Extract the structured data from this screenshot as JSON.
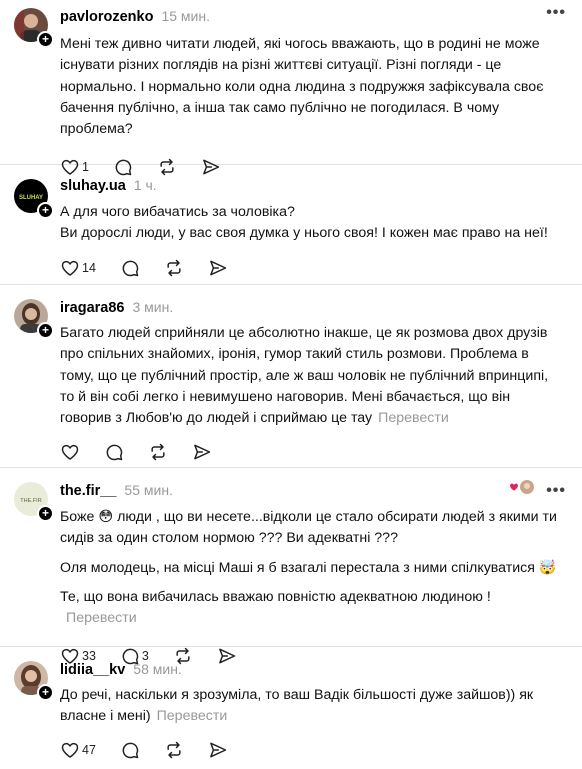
{
  "posts": [
    {
      "username": "pavlorozenko",
      "time": "15 мин.",
      "paragraphs": [
        "Мені теж дивно читати людей, які чогось вважають, що в родині не може існувати різних поглядів на різні життєві ситуації. Різні погляди - це нормально. І нормально коли одна людина з подружжя зафіксувала своє бачення публічно, а інша так само публічно не погодилася. В чому проблема?"
      ],
      "likes": "1",
      "replies": "",
      "translate": ""
    },
    {
      "username": "sluhay.ua",
      "time": "1 ч.",
      "paragraphs": [
        "А для чого вибачатись за чоловіка?",
        "Ви дорослі люди, у вас своя думка у нього своя! І кожен має право на неї!"
      ],
      "likes": "14",
      "replies": "",
      "translate": ""
    },
    {
      "username": "iragara86",
      "time": "3 мин.",
      "paragraphs": [
        "Багато людей сприйняли це абсолютно інакше, це як розмова двох друзів про спільних знайомих, іронія, гумор такий стиль розмови. Проблема в тому, що це публічний простір, але ж ваш чоловік не публічний впринципі, то й він собі легко і невимушено наговорив. Мені вбачається, що він говорив з Любов'ю до людей і сприймаю це тау"
      ],
      "likes": "",
      "replies": "",
      "translate": "Перевести"
    },
    {
      "username": "the.fir__",
      "time": "55 мин.",
      "paragraphs": [
        "Боже 😳 люди , що ви несете...відколи це стало обсирати людей з якими ти сидів за один столом нормою ??? Ви адекватні ???",
        "Оля молодець, на місці Маші я б взагалі перестала з ними спілкуватися 🤯",
        "Те, що вона вибачилась вважаю повністю адекватною людиною !"
      ],
      "likes": "33",
      "replies": "3",
      "translate": "Перевести"
    },
    {
      "username": "lidiia__kv",
      "time": "58 мин.",
      "paragraphs": [
        "До речі, наскільки я зрозуміла, то ваш Вадік більшості дуже зайшов)) як власне і мені)"
      ],
      "likes": "47",
      "replies": "",
      "translate": "Перевести"
    }
  ],
  "avatar_text": {
    "sluhay": "SLUHAY",
    "thefir": "THE.FIR"
  },
  "more_label": "•••",
  "plus_label": "+",
  "colors": {
    "muted": "#999999",
    "divider": "#e3e3e3",
    "heart_red": "#e0245e"
  }
}
